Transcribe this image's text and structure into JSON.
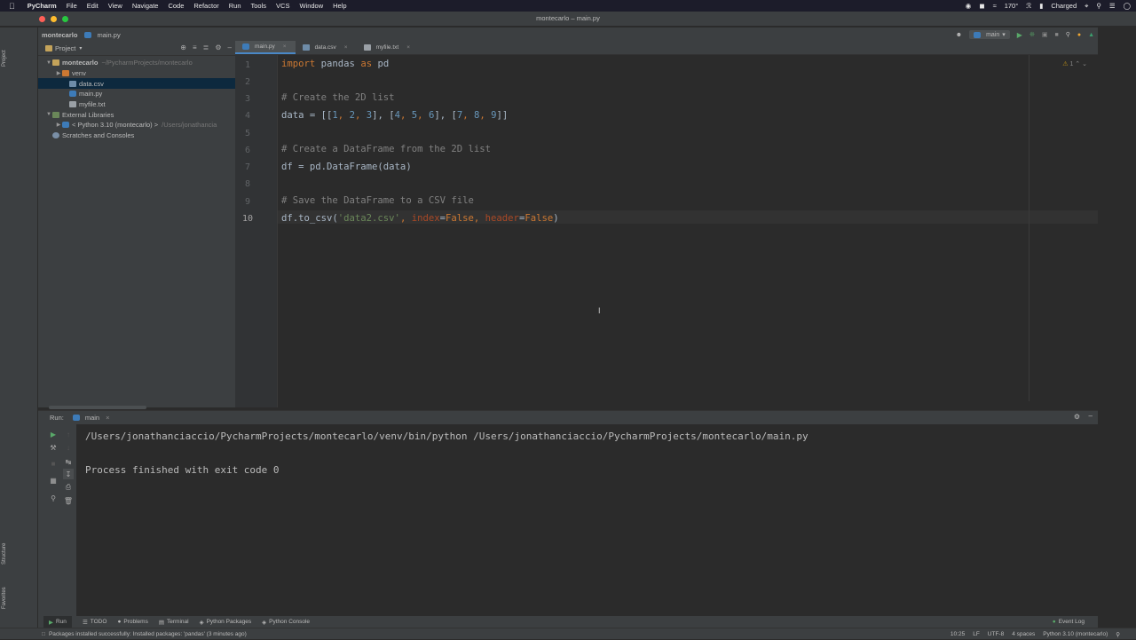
{
  "menubar": {
    "app_name": "PyCharm",
    "items": [
      "File",
      "Edit",
      "View",
      "Navigate",
      "Code",
      "Refactor",
      "Run",
      "Tools",
      "VCS",
      "Window",
      "Help"
    ],
    "tray": {
      "temp": "170°",
      "battery": "Charged"
    }
  },
  "window": {
    "title": "montecarlo – main.py"
  },
  "navbar": {
    "project": "montecarlo",
    "file": "main.py",
    "run_config": "main"
  },
  "project_panel": {
    "title": "Project",
    "tree": {
      "root": {
        "name": "montecarlo",
        "path": "~/PycharmProjects/montecarlo"
      },
      "venv": "venv",
      "files": [
        "data.csv",
        "main.py",
        "myfile.txt"
      ],
      "external_libraries": "External Libraries",
      "python_sdk": {
        "name": "< Python 3.10 (montecarlo) >",
        "path": "/Users/jonathancia"
      },
      "scratches": "Scratches and Consoles"
    }
  },
  "editor": {
    "tabs": [
      {
        "label": "main.py",
        "active": true
      },
      {
        "label": "data.csv",
        "active": false
      },
      {
        "label": "myfile.txt",
        "active": false
      }
    ],
    "line_numbers": [
      "1",
      "2",
      "3",
      "4",
      "5",
      "6",
      "7",
      "8",
      "9",
      "10"
    ],
    "current_line": "10",
    "inspection_count": "1",
    "code": {
      "l1": {
        "kw1": "import",
        "s1": " pandas ",
        "kw2": "as",
        "s2": " pd"
      },
      "l3": "# Create the 2D list",
      "l4": {
        "a": "data = [[",
        "n1": "1",
        ",1": ", ",
        "n2": "2",
        ",2": ", ",
        "n3": "3",
        "b": "], [",
        "n4": "4",
        ",3": ", ",
        "n5": "5",
        ",4": ", ",
        "n6": "6",
        "c": "], [",
        "n7": "7",
        ",5": ", ",
        "n8": "8",
        ",6": ", ",
        "n9": "9",
        "d": "]]"
      },
      "l6": "# Create a DataFrame from the 2D list",
      "l7": "df = pd.DataFrame(data)",
      "l9": "# Save the DataFrame to a CSV file",
      "l10": {
        "a": "df.to_csv(",
        "str": "'data2.csv'",
        "b": ", ",
        "p1": "index",
        "eq1": "=",
        "v1": "False",
        "c": ", ",
        "p2": "header",
        "eq2": "=",
        "v2": "False",
        "d": ")"
      }
    }
  },
  "run_panel": {
    "label": "Run:",
    "config": "main",
    "output_lines": [
      "/Users/jonathanciaccio/PycharmProjects/montecarlo/venv/bin/python /Users/jonathanciaccio/PycharmProjects/montecarlo/main.py",
      "",
      "Process finished with exit code 0"
    ]
  },
  "bottom_tabs": [
    "Run",
    "TODO",
    "Problems",
    "Terminal",
    "Python Packages",
    "Python Console"
  ],
  "event_log": "Event Log",
  "side_labels": {
    "project": "Project",
    "structure": "Structure",
    "favorites": "Favorites"
  },
  "statusbar": {
    "message": "Packages installed successfully: Installed packages: 'pandas' (3 minutes ago)",
    "position": "10:25",
    "line_sep": "LF",
    "encoding": "UTF-8",
    "indent": "4 spaces",
    "interpreter": "Python 3.10 (montecarlo)"
  }
}
